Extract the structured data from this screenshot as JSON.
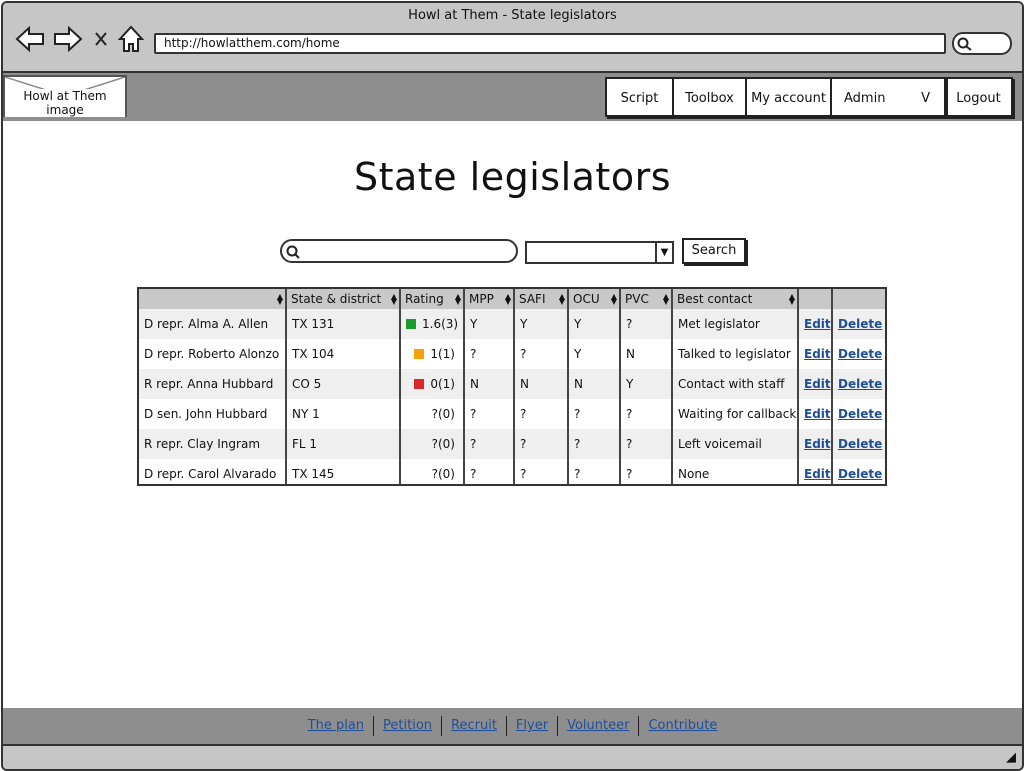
{
  "window": {
    "title": "Howl at Them - State legislators",
    "url": "http://howlatthem.com/home"
  },
  "browser_icons": [
    "back-arrow-icon",
    "forward-arrow-icon",
    "close-x-icon",
    "home-icon",
    "search-icon"
  ],
  "header": {
    "logo_label": "Howl at Them image",
    "menu": [
      {
        "key": "script",
        "label": "Script"
      },
      {
        "key": "toolbox",
        "label": "Toolbox"
      },
      {
        "key": "account",
        "label": "My account"
      },
      {
        "key": "admin",
        "label": "Admin",
        "caret": "V"
      },
      {
        "key": "logout",
        "label": "Logout"
      }
    ]
  },
  "main": {
    "title": "State legislators",
    "search": {
      "value": "",
      "select_value": "",
      "button_label": "Search"
    },
    "table": {
      "columns": [
        "",
        "State & district",
        "Rating",
        "MPP",
        "SAFI",
        "OCU",
        "PVC",
        "Best contact",
        "",
        ""
      ],
      "rows": [
        {
          "name": "D repr. Alma A. Allen",
          "district": "TX 131",
          "rating": "1.6(3)",
          "rating_color": "#1a9a2a",
          "mpp": "Y",
          "safi": "Y",
          "ocu": "Y",
          "pvc": "?",
          "contact": "Met legislator",
          "edit": "Edit",
          "delete": "Delete"
        },
        {
          "name": "D repr. Roberto Alonzo",
          "district": "TX 104",
          "rating": "1(1)",
          "rating_color": "#f5a00a",
          "mpp": "?",
          "safi": "?",
          "ocu": "Y",
          "pvc": "N",
          "contact": "Talked to legislator",
          "edit": "Edit",
          "delete": "Delete"
        },
        {
          "name": "R repr. Anna Hubbard",
          "district": "CO 5",
          "rating": "0(1)",
          "rating_color": "#d8282a",
          "mpp": "N",
          "safi": "N",
          "ocu": "N",
          "pvc": "Y",
          "contact": "Contact with staff",
          "edit": "Edit",
          "delete": "Delete"
        },
        {
          "name": "D sen. John Hubbard",
          "district": "NY 1",
          "rating": "?(0)",
          "rating_color": "",
          "mpp": "?",
          "safi": "?",
          "ocu": "?",
          "pvc": "?",
          "contact": "Waiting for callback",
          "edit": "Edit",
          "delete": "Delete"
        },
        {
          "name": "R repr. Clay Ingram",
          "district": "FL 1",
          "rating": "?(0)",
          "rating_color": "",
          "mpp": "?",
          "safi": "?",
          "ocu": "?",
          "pvc": "?",
          "contact": "Left voicemail",
          "edit": "Edit",
          "delete": "Delete"
        },
        {
          "name": "D repr. Carol Alvarado",
          "district": "TX 145",
          "rating": "?(0)",
          "rating_color": "",
          "mpp": "?",
          "safi": "?",
          "ocu": "?",
          "pvc": "?",
          "contact": "None",
          "edit": "Edit",
          "delete": "Delete"
        }
      ]
    }
  },
  "footer": {
    "links": [
      "The plan",
      "Petition",
      "Recruit",
      "Flyer",
      "Volunteer",
      "Contribute"
    ]
  }
}
